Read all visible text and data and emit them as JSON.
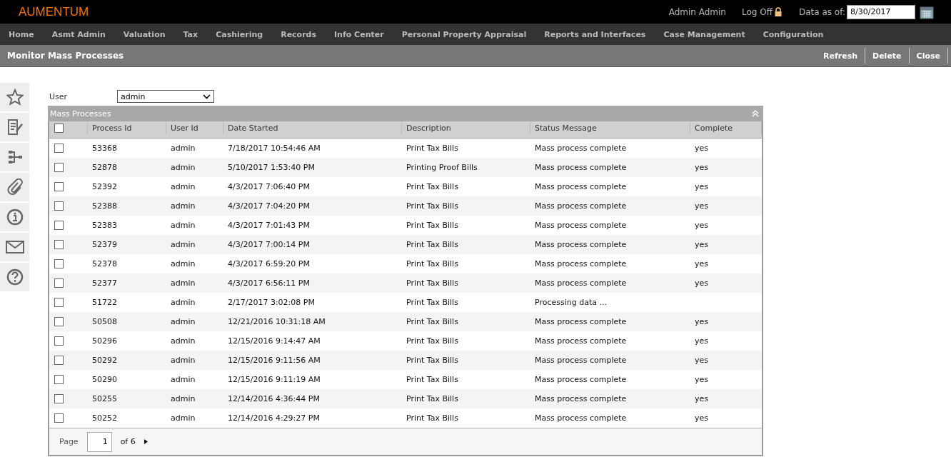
{
  "header": {
    "logo": "AUMENTUM",
    "user": "Admin Admin",
    "log_off": "Log Off",
    "data_as_of_label": "Data as of:",
    "data_as_of_value": "8/30/2017"
  },
  "nav": [
    "Home",
    "Asmt Admin",
    "Valuation",
    "Tax",
    "Cashiering",
    "Records",
    "Info Center",
    "Personal Property Appraisal",
    "Reports and Interfaces",
    "Case Management",
    "Configuration"
  ],
  "page_title": "Monitor Mass Processes",
  "actions": [
    "Refresh",
    "Delete",
    "Close"
  ],
  "sidebar": [
    {
      "kind": "star"
    },
    {
      "kind": "notes"
    },
    {
      "kind": "tree"
    },
    {
      "kind": "attach"
    },
    {
      "kind": "info"
    },
    {
      "kind": "mail"
    },
    {
      "kind": "help"
    }
  ],
  "filter": {
    "label": "User",
    "value": "admin"
  },
  "grid": {
    "title": "Mass Processes",
    "select_all_checked": false,
    "columns": [
      "Process Id",
      "User Id",
      "Date Started",
      "Description",
      "Status Message",
      "Complete"
    ],
    "rows": [
      {
        "checked": false,
        "cells": [
          "53368",
          "admin",
          "7/18/2017 10:54:46 AM",
          "Print Tax Bills",
          "Mass process complete",
          "yes"
        ]
      },
      {
        "checked": false,
        "cells": [
          "52878",
          "admin",
          "5/10/2017 1:53:40 PM",
          "Printing Proof Bills",
          "Mass process complete",
          "yes"
        ]
      },
      {
        "checked": false,
        "cells": [
          "52392",
          "admin",
          "4/3/2017 7:06:40 PM",
          "Print Tax Bills",
          "Mass process complete",
          "yes"
        ]
      },
      {
        "checked": false,
        "cells": [
          "52388",
          "admin",
          "4/3/2017 7:04:20 PM",
          "Print Tax Bills",
          "Mass process complete",
          "yes"
        ]
      },
      {
        "checked": false,
        "cells": [
          "52383",
          "admin",
          "4/3/2017 7:01:43 PM",
          "Print Tax Bills",
          "Mass process complete",
          "yes"
        ]
      },
      {
        "checked": false,
        "cells": [
          "52379",
          "admin",
          "4/3/2017 7:00:14 PM",
          "Print Tax Bills",
          "Mass process complete",
          "yes"
        ]
      },
      {
        "checked": false,
        "cells": [
          "52378",
          "admin",
          "4/3/2017 6:59:20 PM",
          "Print Tax Bills",
          "Mass process complete",
          "yes"
        ]
      },
      {
        "checked": false,
        "cells": [
          "52377",
          "admin",
          "4/3/2017 6:56:11 PM",
          "Print Tax Bills",
          "Mass process complete",
          "yes"
        ]
      },
      {
        "checked": false,
        "cells": [
          "51722",
          "admin",
          "2/17/2017 3:02:08 PM",
          "Print Tax Bills",
          "Processing data ...",
          ""
        ]
      },
      {
        "checked": false,
        "cells": [
          "50508",
          "admin",
          "12/21/2016 10:31:18 AM",
          "Print Tax Bills",
          "Mass process complete",
          "yes"
        ]
      },
      {
        "checked": false,
        "cells": [
          "50296",
          "admin",
          "12/15/2016 9:14:47 AM",
          "Print Tax Bills",
          "Mass process complete",
          "yes"
        ]
      },
      {
        "checked": false,
        "cells": [
          "50292",
          "admin",
          "12/15/2016 9:11:56 AM",
          "Print Tax Bills",
          "Mass process complete",
          "yes"
        ]
      },
      {
        "checked": false,
        "cells": [
          "50290",
          "admin",
          "12/15/2016 9:11:19 AM",
          "Print Tax Bills",
          "Mass process complete",
          "yes"
        ]
      },
      {
        "checked": false,
        "cells": [
          "50255",
          "admin",
          "12/14/2016 4:36:44 PM",
          "Print Tax Bills",
          "Mass process complete",
          "yes"
        ]
      },
      {
        "checked": false,
        "cells": [
          "50252",
          "admin",
          "12/14/2016 4:29:27 PM",
          "Print Tax Bills",
          "Mass process complete",
          "yes"
        ]
      }
    ],
    "pager": {
      "label": "Page",
      "value": "1",
      "of": "of 6"
    }
  }
}
